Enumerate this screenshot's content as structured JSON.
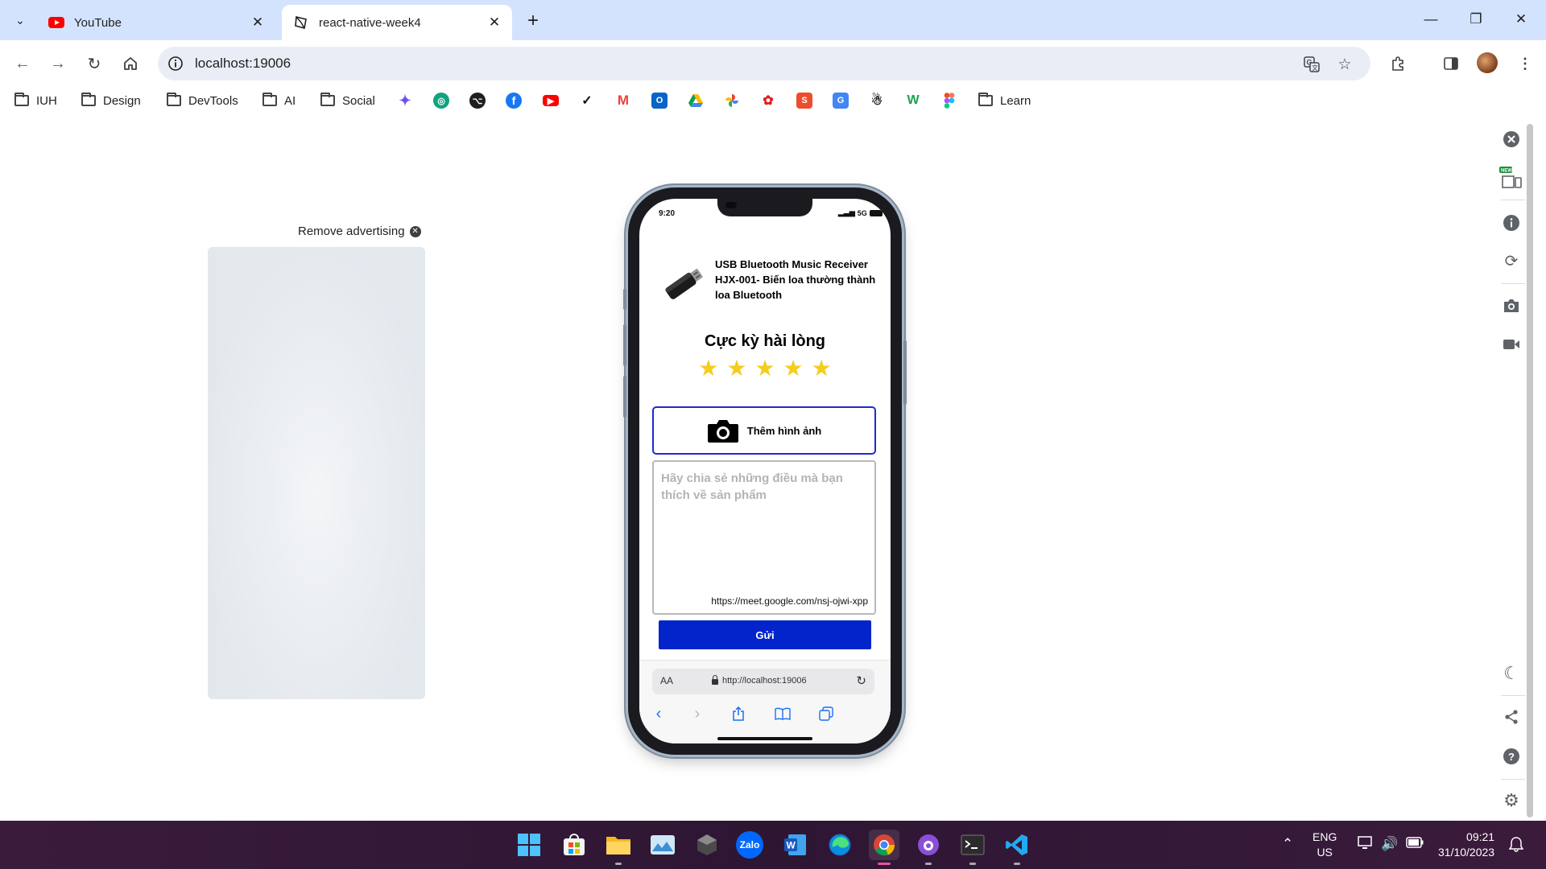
{
  "tabs": [
    {
      "title": "YouTube",
      "active": false
    },
    {
      "title": "react-native-week4",
      "active": true
    }
  ],
  "window_controls": [
    "minimize",
    "restore",
    "close"
  ],
  "address_bar": {
    "url": "localhost:19006"
  },
  "bookmarks": {
    "folders": [
      "IUH",
      "Design",
      "DevTools",
      "AI",
      "Social",
      "Learn"
    ],
    "icons": [
      "gemini-icon",
      "chatgpt-icon",
      "github-icon",
      "facebook-icon",
      "youtube-icon",
      "nike-icon",
      "gmail-icon",
      "outlook-icon",
      "google-drive-icon",
      "google-photos-icon",
      "huawei-icon",
      "shopee-icon",
      "google-translate-icon",
      "penguin-icon",
      "w-icon",
      "figma-icon"
    ]
  },
  "ad": {
    "remove_label": "Remove advertising"
  },
  "phone": {
    "status_time": "9:20",
    "status_network": "5G",
    "product_name": "USB Bluetooth Music Receiver HJX-001- Biến loa thường thành loa Bluetooth",
    "rating_title": "Cực kỳ hài lòng",
    "stars": 5,
    "star_glyph": "★",
    "star_color": "#f5cc1f",
    "add_photo_label": "Thêm hình ảnh",
    "review_placeholder": "Hãy chia sẻ những điều mà bạn thích về sản phẩm",
    "review_link": "https://meet.google.com/nsj-ojwi-xpp",
    "send_label": "Gửi",
    "send_color": "#0324cb",
    "safari": {
      "aa": "AA",
      "url": "http://localhost:19006"
    }
  },
  "side_panel_icons": [
    "close-icon",
    "responsive-new-icon",
    "info-icon",
    "rotate-icon",
    "screenshot-icon",
    "video-icon",
    "dark-mode-icon",
    "share-icon",
    "help-icon",
    "settings-icon"
  ],
  "taskbar": {
    "apps": [
      "start-icon",
      "store-icon",
      "file-explorer-icon",
      "photos-icon",
      "unity-icon",
      "zalo-icon",
      "word-icon",
      "edge-icon",
      "chrome-icon",
      "github-desktop-icon",
      "terminal-icon",
      "vscode-icon"
    ],
    "lang": "ENG",
    "region": "US",
    "time": "09:21",
    "date": "31/10/2023"
  }
}
